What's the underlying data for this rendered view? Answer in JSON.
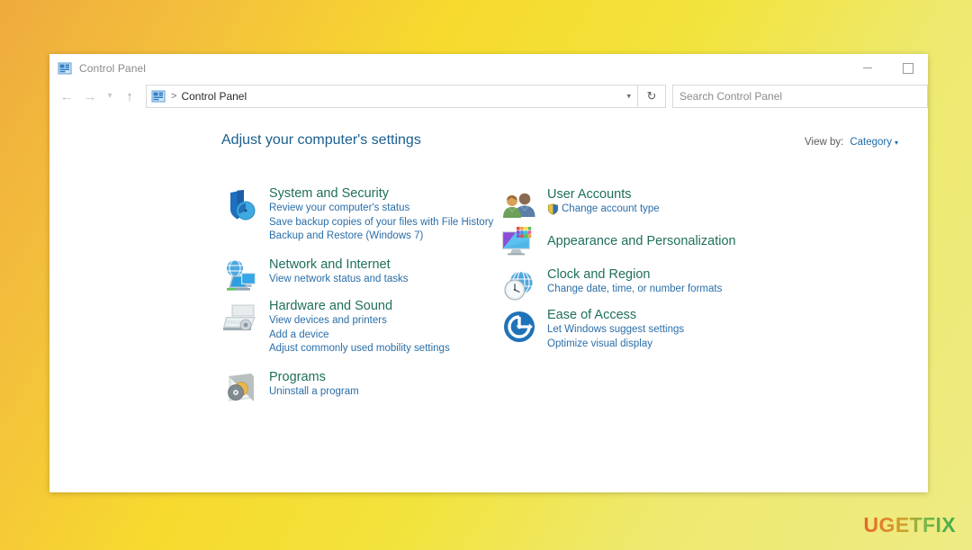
{
  "window": {
    "title": "Control Panel",
    "icon": "control-panel-icon",
    "controls": {
      "minimize": "minimize-button",
      "maximize": "maximize-button"
    }
  },
  "navigation": {
    "back": "back-arrow-icon",
    "forward": "forward-arrow-icon",
    "recent": "chevron-down-icon",
    "up": "up-arrow-icon",
    "breadcrumb": {
      "icon": "control-panel-icon",
      "separator": ">",
      "path": "Control Panel",
      "dropdown": "chevron-down-icon"
    },
    "refresh": "refresh-icon"
  },
  "search": {
    "placeholder": "Search Control Panel",
    "value": ""
  },
  "main": {
    "heading": "Adjust your computer's settings",
    "view_by": {
      "label": "View by:",
      "value": "Category",
      "caret": "▾"
    },
    "categories_left": [
      {
        "icon": "shield-security-icon",
        "title": "System and Security",
        "links": [
          "Review your computer's status",
          "Save backup copies of your files with File History",
          "Backup and Restore (Windows 7)"
        ]
      },
      {
        "icon": "network-internet-icon",
        "title": "Network and Internet",
        "links": [
          "View network status and tasks"
        ]
      },
      {
        "icon": "hardware-sound-icon",
        "title": "Hardware and Sound",
        "links": [
          "View devices and printers",
          "Add a device",
          "Adjust commonly used mobility settings"
        ]
      },
      {
        "icon": "programs-icon",
        "title": "Programs",
        "links": [
          "Uninstall a program"
        ]
      }
    ],
    "categories_right": [
      {
        "icon": "user-accounts-icon",
        "title": "User Accounts",
        "links": [
          "Change account type"
        ],
        "link_shield": true
      },
      {
        "icon": "appearance-personalization-icon",
        "title": "Appearance and Personalization",
        "links": []
      },
      {
        "icon": "clock-region-icon",
        "title": "Clock and Region",
        "links": [
          "Change date, time, or number formats"
        ]
      },
      {
        "icon": "ease-of-access-icon",
        "title": "Ease of Access",
        "links": [
          "Let Windows suggest settings",
          "Optimize visual display"
        ]
      }
    ]
  },
  "watermark": {
    "text": "UGETFIX"
  },
  "colors": {
    "category_title": "#1f6f5c",
    "link": "#2a6ea8",
    "heading": "#1b5e8e",
    "desktop_start": "#efab3d",
    "desktop_end": "#eeeb84"
  }
}
